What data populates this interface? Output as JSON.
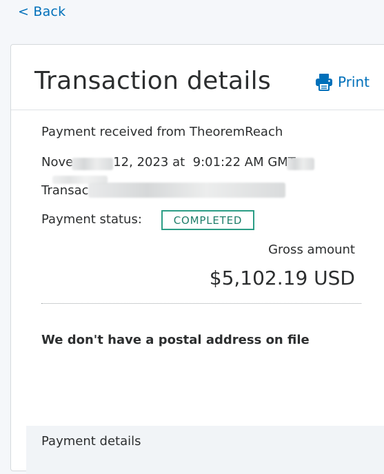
{
  "nav": {
    "back_label": "< Back"
  },
  "header": {
    "title": "Transaction details",
    "print_label": "Print",
    "print_icon": "printer-icon"
  },
  "transaction": {
    "received_from": "Payment received from TheoremReach",
    "date_prefix": "Nove",
    "date_middle": "12, 2023 at",
    "date_time": "9:01:22 AM GMT",
    "transaction_id_prefix": "Transac",
    "status_label": "Payment status:",
    "status_value": "COMPLETED"
  },
  "amount": {
    "label": "Gross amount",
    "value": "$5,102.19 USD"
  },
  "address": {
    "note": "We don't have a postal address on file"
  },
  "payment_details": {
    "title": "Payment details"
  },
  "colors": {
    "link": "#0070ba",
    "status_border": "#2b9d85",
    "status_text": "#1e7e6a",
    "text": "#2c2e2f"
  }
}
